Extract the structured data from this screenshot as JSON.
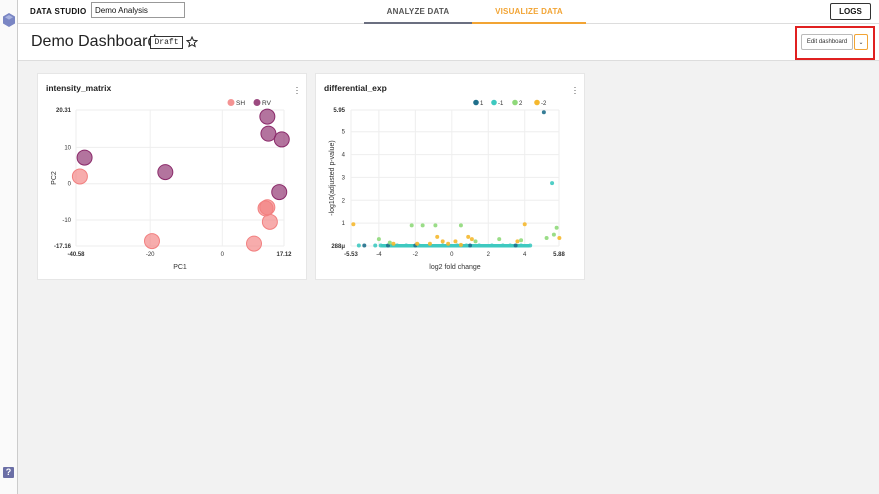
{
  "app": {
    "brand": "DATA STUDIO",
    "analysis_name": "Demo Analysis"
  },
  "nav": {
    "tabs": [
      {
        "label": "ANALYZE DATA",
        "active": false
      },
      {
        "label": "VISUALIZE DATA",
        "active": true
      }
    ],
    "logs_label": "LOGS"
  },
  "dashboard": {
    "title": "Demo Dashboard",
    "status_badge": "Draft",
    "edit_label": "Edit dashboard",
    "dropdown_glyph": "⌄"
  },
  "colors": {
    "accent": "#f2a434",
    "highlight": "#e02020",
    "SH": "#f28080",
    "RV": "#8b2a6a",
    "de_1": "#1f6f8b",
    "de_neg1": "#3ec9c0",
    "de_2": "#8fd97a",
    "de_neg2": "#f5b82e"
  },
  "icons": {
    "logo": "layers-icon",
    "help": "help-icon",
    "star": "star-icon",
    "menu": "kebab-menu-icon"
  },
  "help_glyph": "?",
  "charts": {
    "chart_data": [
      {
        "type": "scatter",
        "title": "intensity_matrix",
        "xlabel": "PC1",
        "ylabel": "PC2",
        "xlim": [
          -40.58,
          17.12
        ],
        "ylim": [
          -17.16,
          20.31
        ],
        "x_ticks": [
          "-40.58",
          "-20",
          "0",
          "17.12"
        ],
        "y_ticks": [
          "20.31",
          "10",
          "0",
          "-10",
          "-17.16"
        ],
        "legend": [
          "SH",
          "RV"
        ],
        "legend_position": "top-right",
        "series": [
          {
            "name": "SH",
            "points": [
              [
                -39.5,
                2.0
              ],
              [
                -19.5,
                -15.8
              ],
              [
                8.8,
                -16.5
              ],
              [
                13.2,
                -10.5
              ],
              [
                12.5,
                -6.5
              ],
              [
                12.0,
                -6.8
              ]
            ]
          },
          {
            "name": "RV",
            "points": [
              [
                -38.2,
                7.2
              ],
              [
                -15.8,
                3.2
              ],
              [
                12.5,
                18.5
              ],
              [
                12.8,
                13.8
              ],
              [
                16.5,
                12.2
              ],
              [
                15.8,
                -2.3
              ]
            ]
          }
        ]
      },
      {
        "type": "scatter",
        "title": "differential_exp",
        "xlabel": "log2 fold change",
        "ylabel": "-log10(adjusted p-value)",
        "xlim": [
          -5.53,
          5.88
        ],
        "ylim": [
          0,
          5.95
        ],
        "x_ticks": [
          "-5.53",
          "-4",
          "-2",
          "0",
          "2",
          "4",
          "5.88"
        ],
        "y_ticks": [
          "5.95",
          "5",
          "4",
          "3",
          "2",
          "1",
          "288μ"
        ],
        "legend": [
          "1",
          "-1",
          "2",
          "-2"
        ],
        "legend_position": "top-right",
        "series": [
          {
            "name": "1",
            "points": [
              [
                -4.8,
                0.02
              ],
              [
                -3.5,
                0.02
              ],
              [
                -2.0,
                0.02
              ],
              [
                1.0,
                0.02
              ],
              [
                3.5,
                0.02
              ],
              [
                5.05,
                5.85
              ]
            ]
          },
          {
            "name": "-1",
            "points": [
              [
                -5.1,
                0.02
              ],
              [
                -4.2,
                0.02
              ],
              [
                -3.9,
                0.02
              ],
              [
                -3.0,
                0.02
              ],
              [
                -2.5,
                0.02
              ],
              [
                -1.8,
                0.02
              ],
              [
                -1.2,
                0.02
              ],
              [
                -0.5,
                0.02
              ],
              [
                0.3,
                0.02
              ],
              [
                0.8,
                0.02
              ],
              [
                1.5,
                0.02
              ],
              [
                2.2,
                0.02
              ],
              [
                2.8,
                0.02
              ],
              [
                3.2,
                0.02
              ],
              [
                3.8,
                0.02
              ],
              [
                4.3,
                0.02
              ],
              [
                5.5,
                2.75
              ]
            ]
          },
          {
            "name": "2",
            "points": [
              [
                -4.0,
                0.3
              ],
              [
                -3.4,
                0.15
              ],
              [
                -2.2,
                0.9
              ],
              [
                -1.6,
                0.9
              ],
              [
                -0.9,
                0.9
              ],
              [
                0.5,
                0.9
              ],
              [
                1.3,
                0.2
              ],
              [
                2.6,
                0.3
              ],
              [
                3.8,
                0.25
              ],
              [
                5.2,
                0.35
              ],
              [
                5.6,
                0.5
              ],
              [
                5.75,
                0.8
              ]
            ]
          },
          {
            "name": "-2",
            "points": [
              [
                -5.4,
                0.95
              ],
              [
                -3.2,
                0.1
              ],
              [
                -1.9,
                0.1
              ],
              [
                -1.2,
                0.1
              ],
              [
                -0.8,
                0.4
              ],
              [
                -0.5,
                0.2
              ],
              [
                -0.2,
                0.1
              ],
              [
                0.2,
                0.2
              ],
              [
                0.5,
                0.05
              ],
              [
                0.9,
                0.4
              ],
              [
                1.1,
                0.3
              ],
              [
                3.6,
                0.2
              ],
              [
                4.0,
                0.95
              ],
              [
                5.9,
                0.35
              ]
            ]
          }
        ]
      }
    ]
  }
}
